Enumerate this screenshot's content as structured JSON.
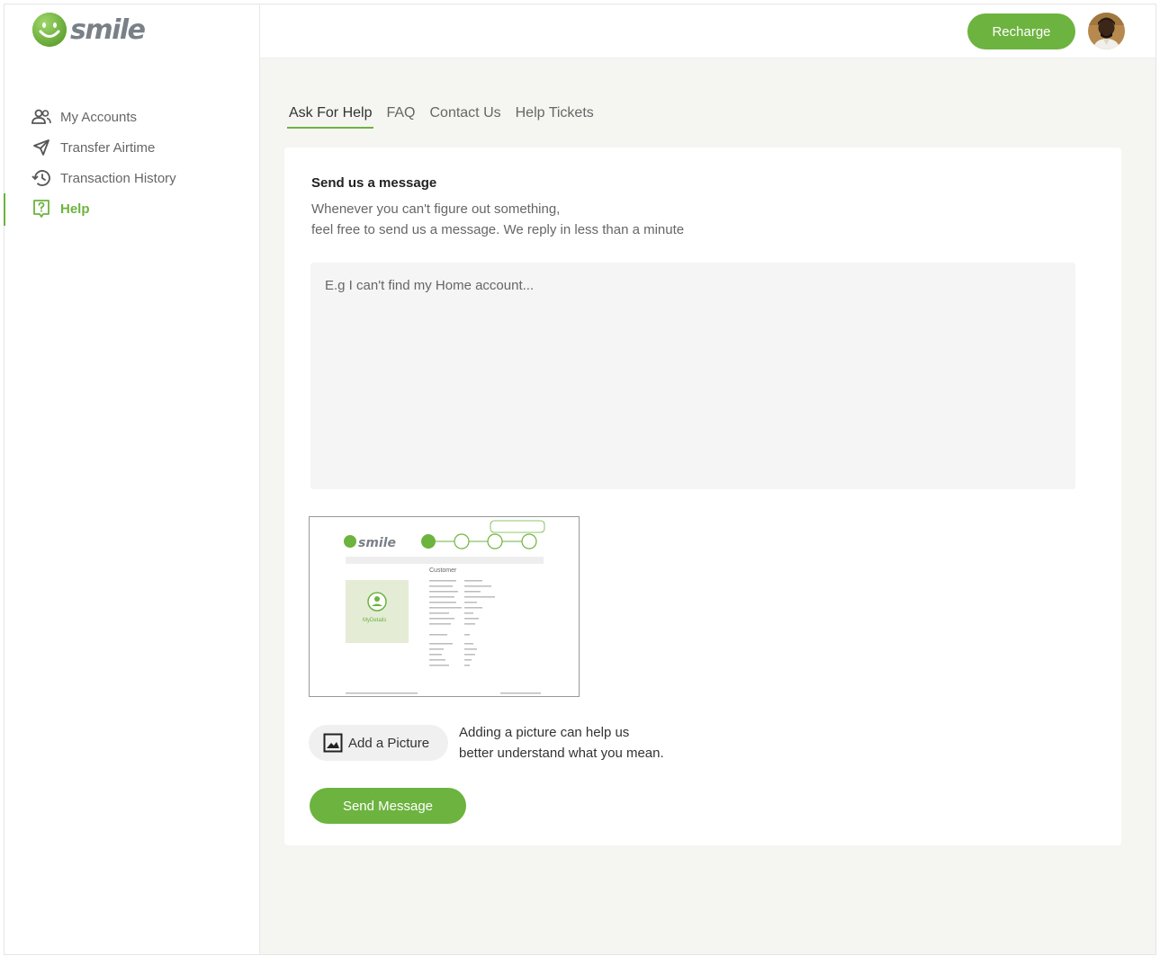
{
  "app": {
    "logo_text": "smile",
    "brand_color": "#6db33f"
  },
  "sidebar": {
    "items": [
      {
        "label": "My Accounts",
        "icon": "people-icon",
        "active": false
      },
      {
        "label": "Transfer Airtime",
        "icon": "send-icon",
        "active": false
      },
      {
        "label": "Transaction History",
        "icon": "history-icon",
        "active": false
      },
      {
        "label": "Help",
        "icon": "help-icon",
        "active": true
      }
    ]
  },
  "header": {
    "recharge_label": "Recharge",
    "avatar_icon": "user-avatar"
  },
  "tabs": [
    {
      "label": "Ask For Help",
      "active": true
    },
    {
      "label": "FAQ",
      "active": false
    },
    {
      "label": "Contact Us",
      "active": false
    },
    {
      "label": "Help Tickets",
      "active": false
    }
  ],
  "form": {
    "title": "Send us a message",
    "subtitle_line1": "Whenever you can't figure out something,",
    "subtitle_line2": "feel free to send us a message. We reply in less than a minute",
    "message_placeholder": "E.g I can't find my Home account...",
    "message_value": "",
    "add_picture_label": "Add a Picture",
    "picture_hint_line1": "Adding a picture can help us",
    "picture_hint_line2": "better understand what you mean.",
    "send_label": "Send Message"
  },
  "attachment": {
    "logo_text": "smile",
    "section_title": "Customer",
    "card_label": "MyDetails"
  }
}
